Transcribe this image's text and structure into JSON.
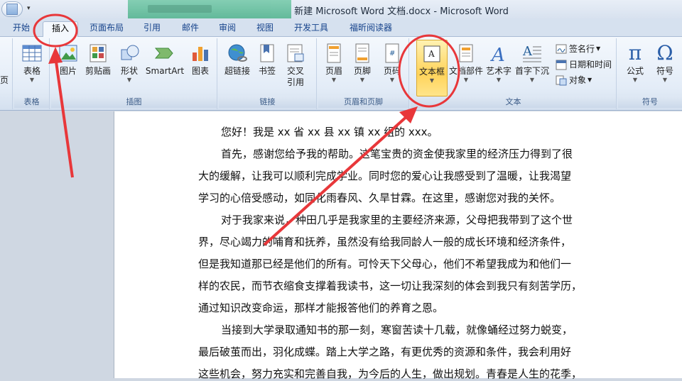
{
  "window": {
    "title": "新建 Microsoft Word 文档.docx - Microsoft Word"
  },
  "tabs": [
    {
      "label": "开始"
    },
    {
      "label": "插入"
    },
    {
      "label": "页面布局"
    },
    {
      "label": "引用"
    },
    {
      "label": "邮件"
    },
    {
      "label": "审阅"
    },
    {
      "label": "视图"
    },
    {
      "label": "开发工具"
    },
    {
      "label": "福昕阅读器"
    }
  ],
  "ribbon": {
    "table_group": {
      "label": "表格",
      "table_btn": "表格"
    },
    "illustrations_group": {
      "label": "插图",
      "picture": "图片",
      "clipart": "剪贴画",
      "shapes": "形状",
      "smartart": "SmartArt",
      "chart": "图表"
    },
    "links_group": {
      "label": "链接",
      "hyperlink": "超链接",
      "bookmark": "书签",
      "crossref_1": "交叉",
      "crossref_2": "引用"
    },
    "headerfooter_group": {
      "label": "页眉和页脚",
      "header": "页眉",
      "footer": "页脚",
      "pagenum": "页码"
    },
    "text_group": {
      "label": "文本",
      "textbox": "文本框",
      "quickparts": "文档部件",
      "wordart": "艺术字",
      "dropcap": "首字下沉",
      "signature": "签名行",
      "datetime": "日期和时间",
      "object": "对象"
    },
    "symbols_group": {
      "label": "符号",
      "equation": "公式",
      "symbol": "符号"
    },
    "left_partial": {
      "label": "页"
    }
  },
  "document": {
    "lines": [
      "您好！我是 xx 省 xx 县 xx 镇 xx 组的 xxx。",
      "首先，感谢您给予我的帮助。这笔宝贵的资金使我家里的经济压力得到了很",
      "大的缓解，让我可以顺利完成学业。同时您的爱心让我感受到了温暖，让我渴望",
      "学习的心倍受感动，如同化雨春风、久旱甘霖。在这里，感谢您对我的关怀。",
      "对于我家来说，种田几乎是我家里的主要经济来源，父母把我带到了这个世",
      "界，尽心竭力的哺育和抚养，虽然没有给我同龄人一般的成长环境和经济条件，",
      "但是我知道那已经是他们的所有。可怜天下父母心，他们不希望我成为和他们一",
      "样的农民，而节衣缩食支撑着我读书，这一切让我深刻的体会到我只有刻苦学历，",
      "通过知识改变命运，那样才能报答他们的养育之恩。",
      "当接到大学录取通知书的那一刻，寒窗苦读十几载，就像蛹经过努力蜕变，",
      "最后破茧而出，羽化成蝶。踏上大学之路，有更优秀的资源和条件，我会利用好",
      "这些机会，努力充实和完善自我，为今后的人生，做出规划。青春是人生的花季，"
    ]
  },
  "colors": {
    "accent": "#15428b",
    "annotation": "#e8373a",
    "highlight": "#ffd35a"
  }
}
